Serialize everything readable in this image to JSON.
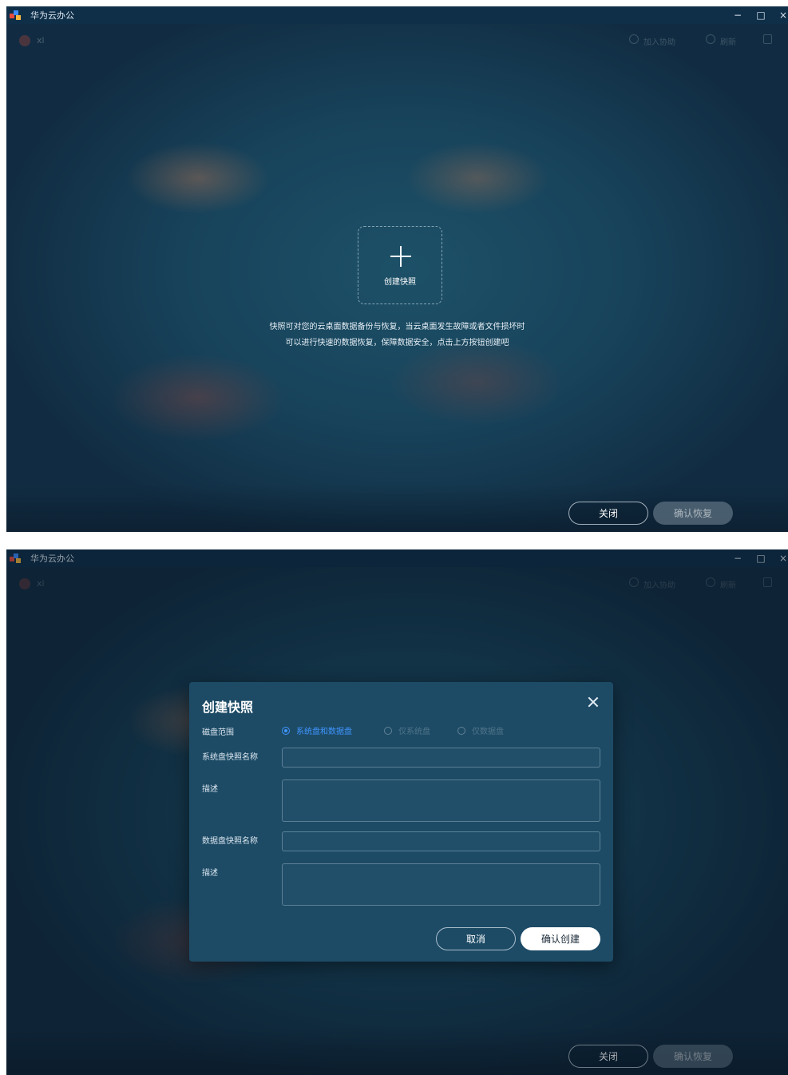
{
  "app": {
    "title": "华为云办公"
  },
  "window_controls": {
    "minimize": "−",
    "maximize": "□",
    "close": "×"
  },
  "toolbar_faint": {
    "user": "xi",
    "join_help": "加入协助",
    "refresh": "刷新"
  },
  "empty_state": {
    "tile_label": "创建快照",
    "description_line1": "快照可对您的云桌面数据备份与恢复，当云桌面发生故障或者文件损坏时",
    "description_line2": "可以进行快速的数据恢复，保障数据安全，点击上方按钮创建吧"
  },
  "footer": {
    "close_label": "关闭",
    "confirm_restore_label": "确认恢复"
  },
  "dialog": {
    "title": "创建快照",
    "disk_scope_label": "磁盘范围",
    "options": [
      "系统盘和数据盘",
      "仅系统盘",
      "仅数据盘"
    ],
    "selected_option": "系统盘和数据盘",
    "system_snapshot_name_label": "系统盘快照名称",
    "system_snapshot_name_value": "",
    "description_label": "描述",
    "system_description_value": "",
    "data_snapshot_name_label": "数据盘快照名称",
    "data_snapshot_name_value": "",
    "data_description_label": "描述",
    "data_description_value": "",
    "cancel_label": "取消",
    "confirm_label": "确认创建"
  },
  "colors": {
    "accent": "#3f95ff",
    "dialog_bg": "#1d4b66",
    "titlebar_bg": "#0f2f49"
  }
}
